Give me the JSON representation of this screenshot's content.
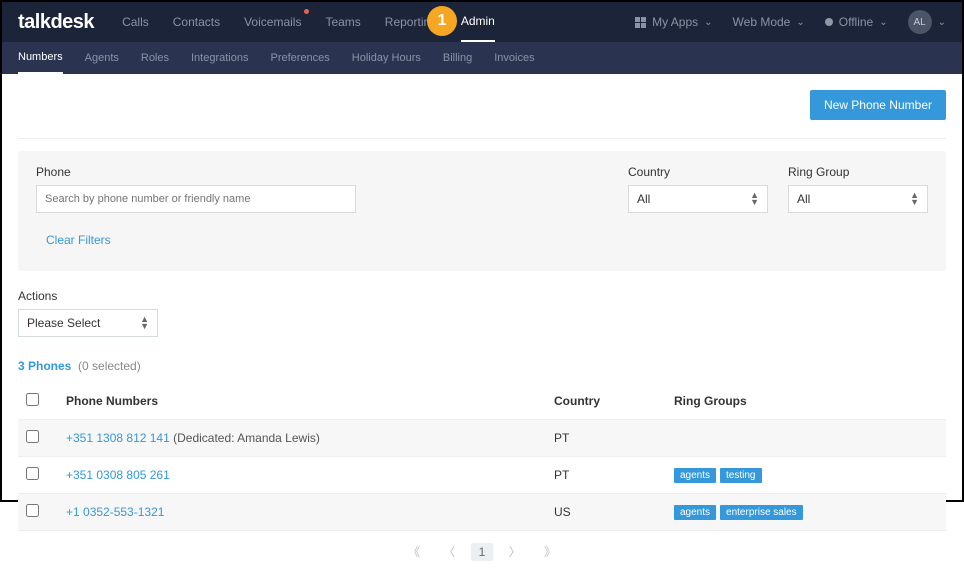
{
  "brand": "talkdesk",
  "topnav": [
    {
      "label": "Calls"
    },
    {
      "label": "Contacts"
    },
    {
      "label": "Voicemails",
      "dot": true
    },
    {
      "label": "Teams"
    },
    {
      "label": "Reporting"
    },
    {
      "label": "Admin",
      "active": true
    }
  ],
  "step_badge": "1",
  "topright": {
    "myapps": "My Apps",
    "webmode": "Web Mode",
    "offline": "Offline",
    "avatar": "AL"
  },
  "subnav": [
    {
      "label": "Numbers",
      "active": true
    },
    {
      "label": "Agents"
    },
    {
      "label": "Roles"
    },
    {
      "label": "Integrations"
    },
    {
      "label": "Preferences"
    },
    {
      "label": "Holiday Hours"
    },
    {
      "label": "Billing"
    },
    {
      "label": "Invoices"
    }
  ],
  "buttons": {
    "new_phone": "New Phone Number",
    "clear_filters": "Clear Filters"
  },
  "filters": {
    "phone_label": "Phone",
    "phone_placeholder": "Search by phone number or friendly name",
    "country_label": "Country",
    "country_value": "All",
    "ring_label": "Ring Group",
    "ring_value": "All"
  },
  "actions": {
    "label": "Actions",
    "value": "Please Select"
  },
  "summary": {
    "count": "3 Phones",
    "selected": "(0 selected)"
  },
  "table": {
    "headers": {
      "phone": "Phone Numbers",
      "country": "Country",
      "ring": "Ring Groups"
    },
    "rows": [
      {
        "phone": "+351 1308 812 141",
        "note": "(Dedicated: Amanda Lewis)",
        "country": "PT",
        "tags": []
      },
      {
        "phone": "+351 0308 805 261",
        "note": "",
        "country": "PT",
        "tags": [
          "agents",
          "testing"
        ]
      },
      {
        "phone": "+1 0352-553-1321",
        "note": "",
        "country": "US",
        "tags": [
          "agents",
          "enterprise sales"
        ]
      }
    ]
  },
  "pagination": {
    "first": "《",
    "prev": "〈",
    "page": "1",
    "next": "〉",
    "last": "》"
  }
}
